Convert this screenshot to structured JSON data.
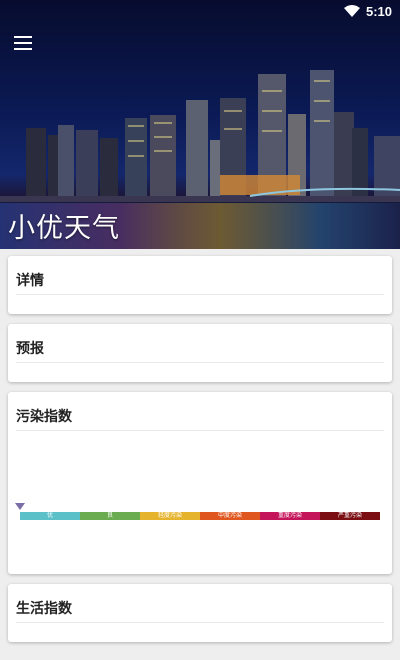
{
  "status_bar": {
    "time": "5:10"
  },
  "app": {
    "title": "小优天气"
  },
  "cards": {
    "details": {
      "title": "详情"
    },
    "forecast": {
      "title": "预报"
    },
    "pollution": {
      "title": "污染指数",
      "scale": [
        {
          "label": "优",
          "color": "#5bc0c8"
        },
        {
          "label": "良",
          "color": "#6aac4f"
        },
        {
          "label": "轻度污染",
          "color": "#e6b32c"
        },
        {
          "label": "中度污染",
          "color": "#e0561f"
        },
        {
          "label": "重度污染",
          "color": "#c4145a"
        },
        {
          "label": "严重污染",
          "color": "#7a0e12"
        }
      ]
    },
    "life": {
      "title": "生活指数"
    }
  }
}
